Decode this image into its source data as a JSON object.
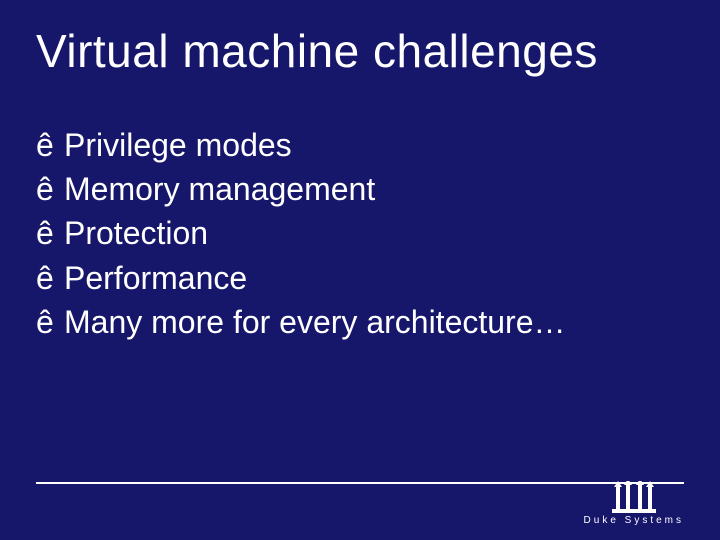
{
  "title": "Virtual machine challenges",
  "bullet_char": "ê",
  "bullets": [
    "Privilege modes",
    "Memory management",
    "Protection",
    "Performance",
    "Many more for every architecture…"
  ],
  "footer_label": "Duke Systems",
  "colors": {
    "background": "#16166b",
    "text": "#ffffff"
  }
}
